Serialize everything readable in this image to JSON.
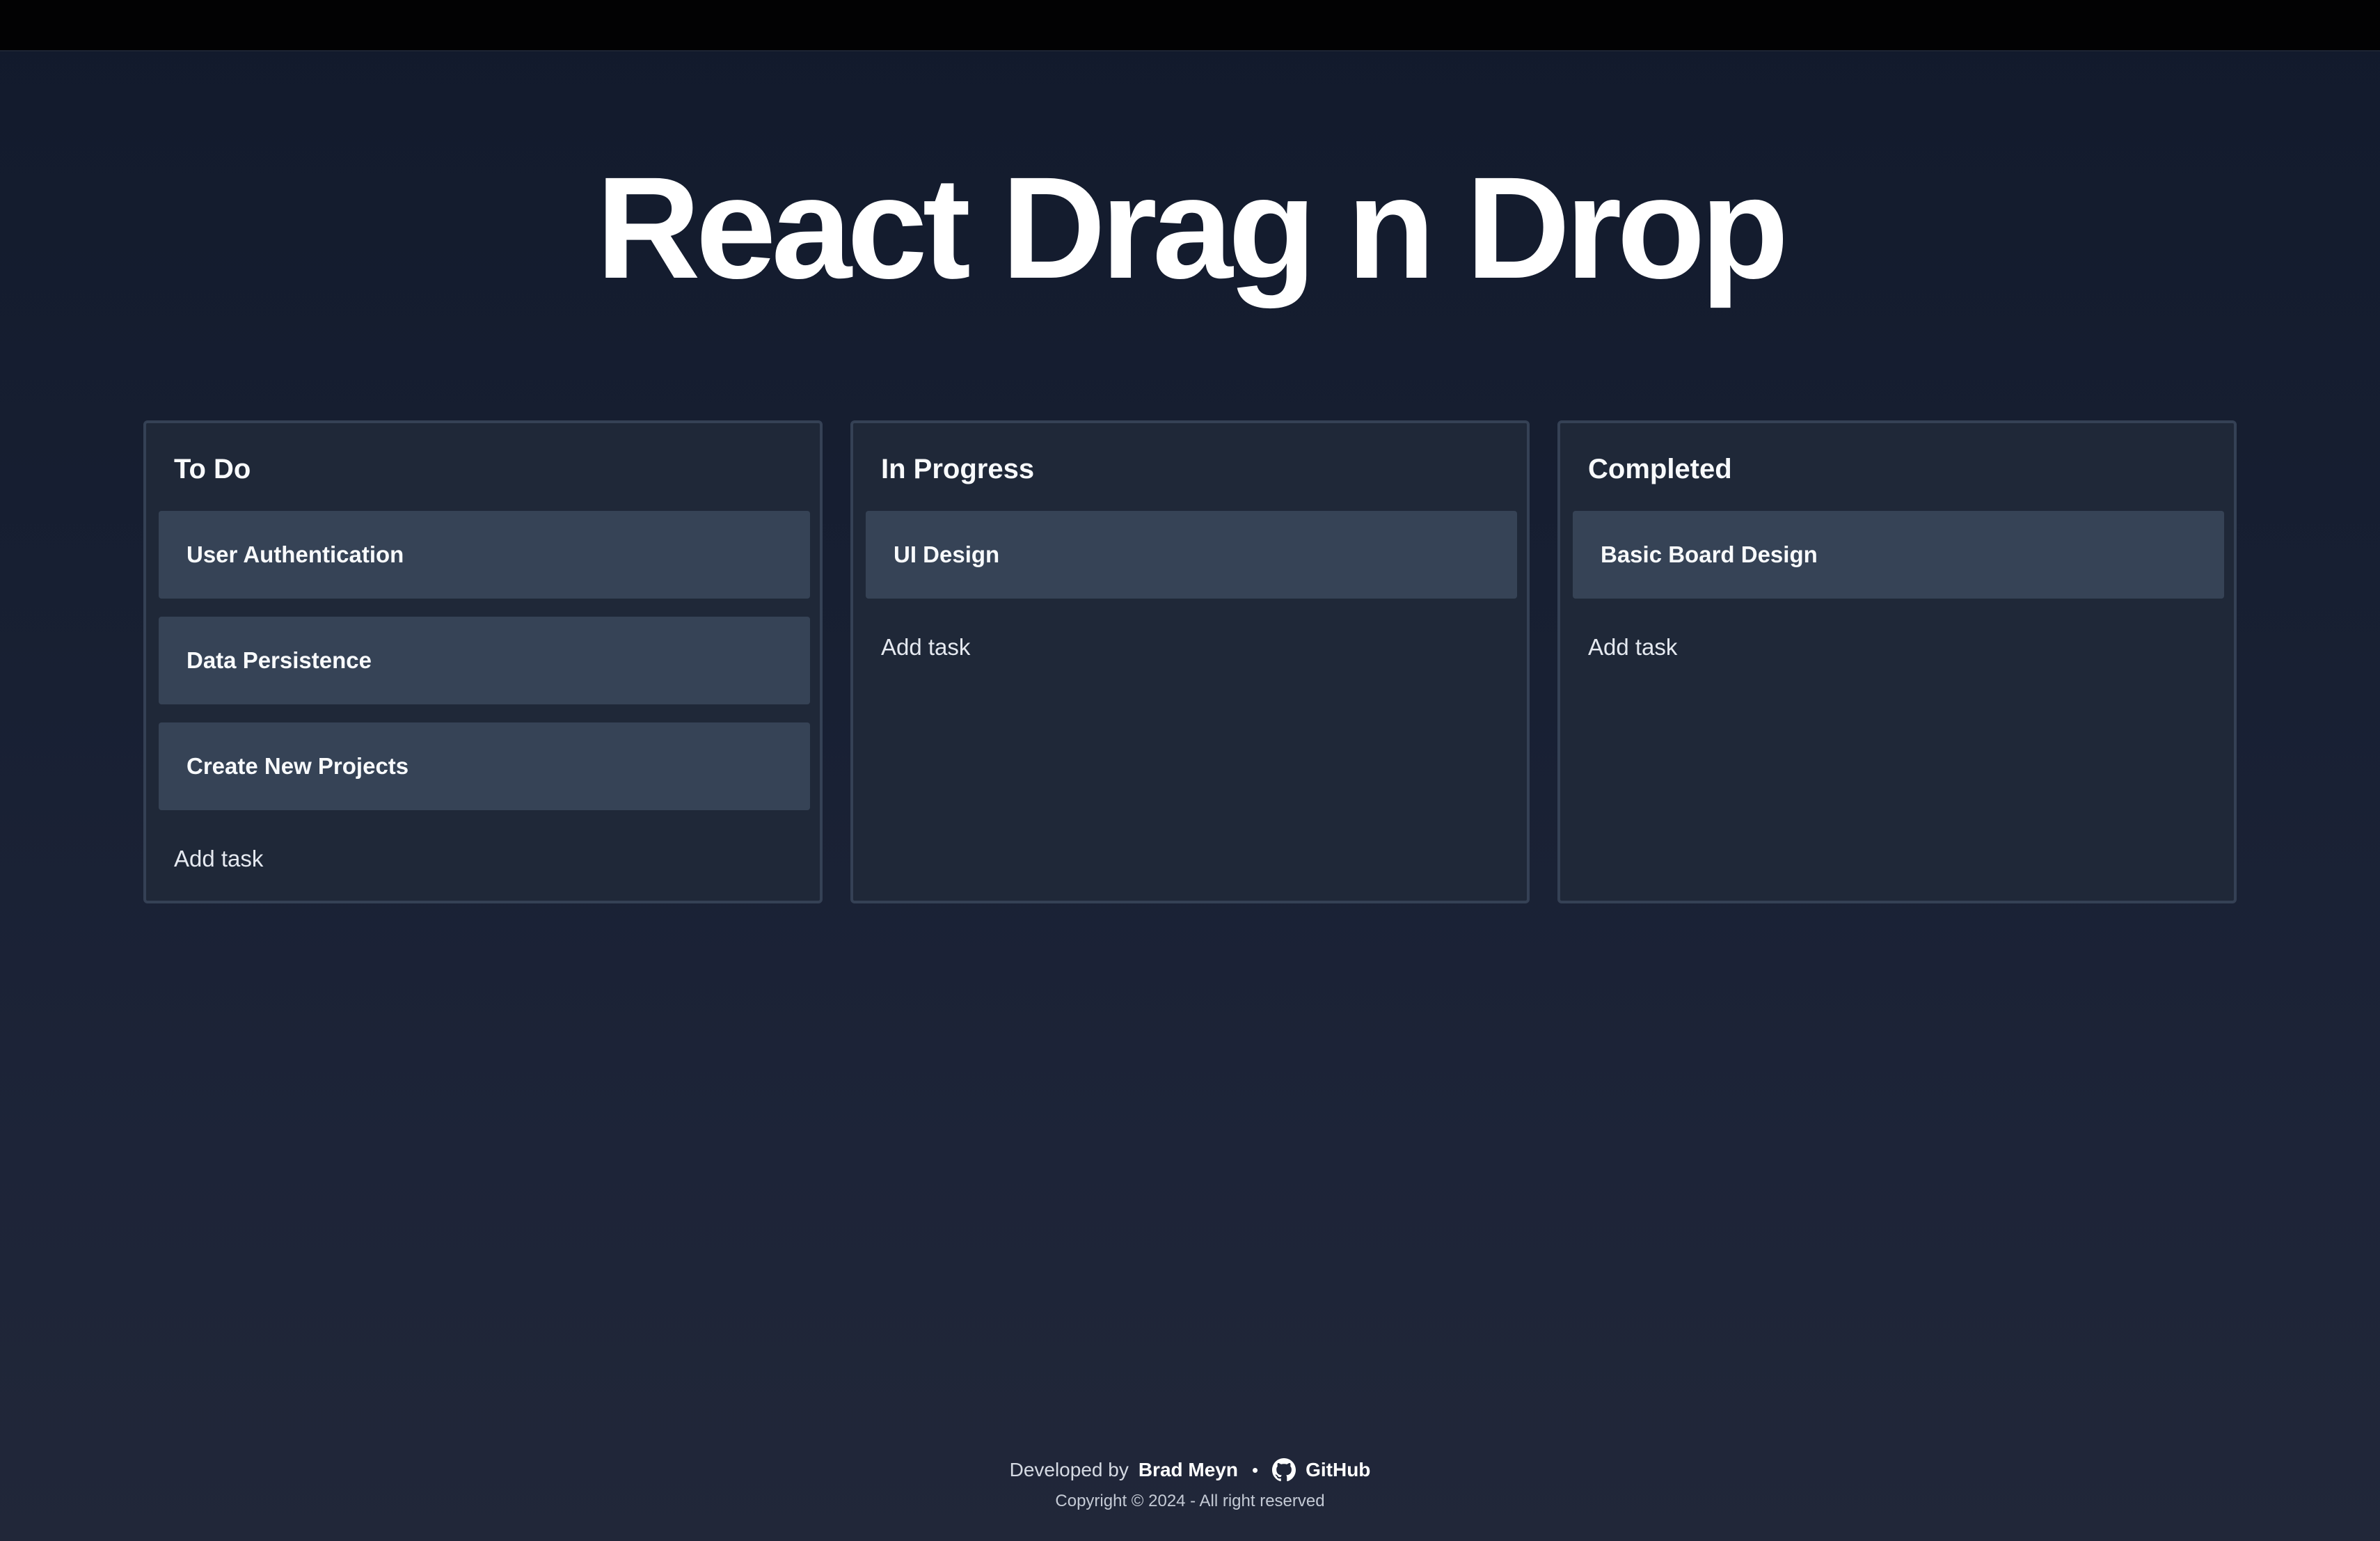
{
  "page": {
    "title": "React Drag n Drop"
  },
  "columns": [
    {
      "title": "To Do",
      "tasks": [
        "User Authentication",
        "Data Persistence",
        "Create New Projects"
      ],
      "add_label": "Add task"
    },
    {
      "title": "In Progress",
      "tasks": [
        "UI Design"
      ],
      "add_label": "Add task"
    },
    {
      "title": "Completed",
      "tasks": [
        "Basic Board Design"
      ],
      "add_label": "Add task"
    }
  ],
  "footer": {
    "developed_by": "Developed by",
    "author": "Brad Meyn",
    "separator": "•",
    "github_label": "GitHub",
    "github_icon": "github-icon",
    "copyright": "Copyright © 2024 - All right reserved"
  },
  "colors": {
    "background_top": "#121a2c",
    "background_bottom": "#212739",
    "column_bg": "#1f2838",
    "column_border": "#354155",
    "card_bg": "#364356",
    "text": "#f8fafc"
  }
}
